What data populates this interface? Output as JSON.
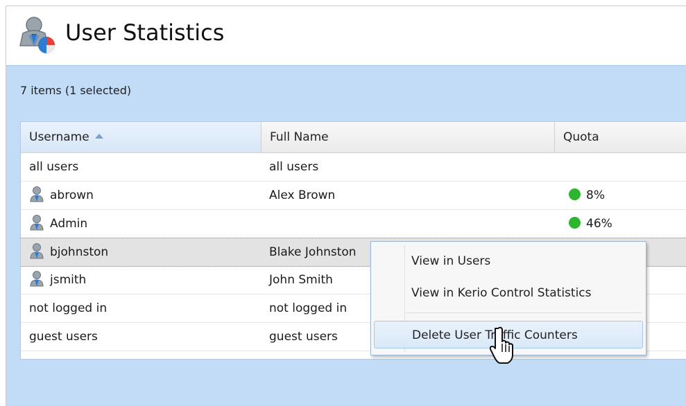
{
  "header": {
    "title": "User Statistics",
    "icon": "user-statistics-icon"
  },
  "grid": {
    "items_count": "7 items (1 selected)",
    "columns": [
      {
        "label": "Username",
        "sorted": "ascending"
      },
      {
        "label": "Full Name"
      },
      {
        "label": "Quota"
      }
    ],
    "rows": [
      {
        "username": "all users",
        "full_name": "all users",
        "quota": "",
        "icon": ""
      },
      {
        "username": "abrown",
        "full_name": "Alex Brown",
        "quota": "8%",
        "icon": "user-icon"
      },
      {
        "username": "Admin",
        "full_name": "",
        "quota": "46%",
        "icon": "user-icon"
      },
      {
        "username": "bjohnston",
        "full_name": "Blake Johnston",
        "quota": "",
        "icon": "user-icon",
        "selected": true
      },
      {
        "username": "jsmith",
        "full_name": "John Smith",
        "quota": "",
        "icon": "user-icon"
      },
      {
        "username": "not logged in",
        "full_name": "not logged in",
        "quota": "",
        "icon": ""
      },
      {
        "username": "guest users",
        "full_name": "guest users",
        "quota": "",
        "icon": ""
      }
    ],
    "quota_ok_color": "#2db52d"
  },
  "context_menu": {
    "items": [
      {
        "label": "View in Users"
      },
      {
        "label": "View in Kerio Control Statistics"
      },
      {
        "label": "Delete User Traffic Counters",
        "hovered": true
      }
    ]
  }
}
